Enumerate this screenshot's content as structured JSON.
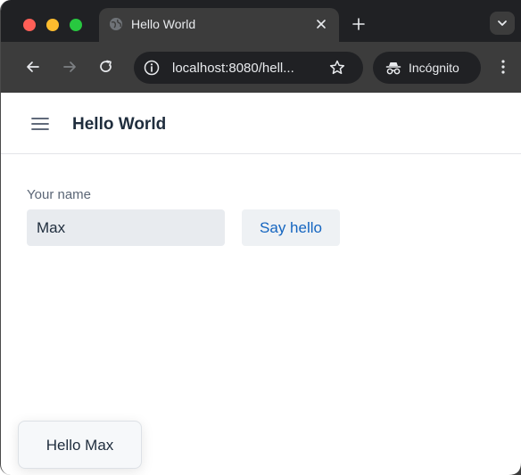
{
  "browser": {
    "tab_title": "Hello World",
    "url": "localhost:8080/hell...",
    "incognito_label": "Incógnito"
  },
  "app": {
    "title": "Hello World",
    "name_label": "Your name",
    "name_value": "Max",
    "button_label": "Say hello",
    "notification_text": "Hello Max"
  },
  "colors": {
    "tab_strip": "#202124",
    "toolbar": "#3c3c3c",
    "accent": "#1465c0",
    "input_bg": "#e8ebef",
    "text": "#1f2d3d"
  },
  "icons": {
    "traffic": [
      "close-dot",
      "minimize-dot",
      "zoom-dot"
    ],
    "tab": [
      "globe-icon",
      "close-icon"
    ],
    "toolbar": [
      "back-arrow-icon",
      "forward-arrow-icon",
      "reload-icon",
      "info-icon",
      "star-icon",
      "incognito-icon",
      "kebab-menu-icon",
      "plus-icon",
      "chevron-down-icon"
    ],
    "app": [
      "hamburger-menu-icon"
    ]
  }
}
